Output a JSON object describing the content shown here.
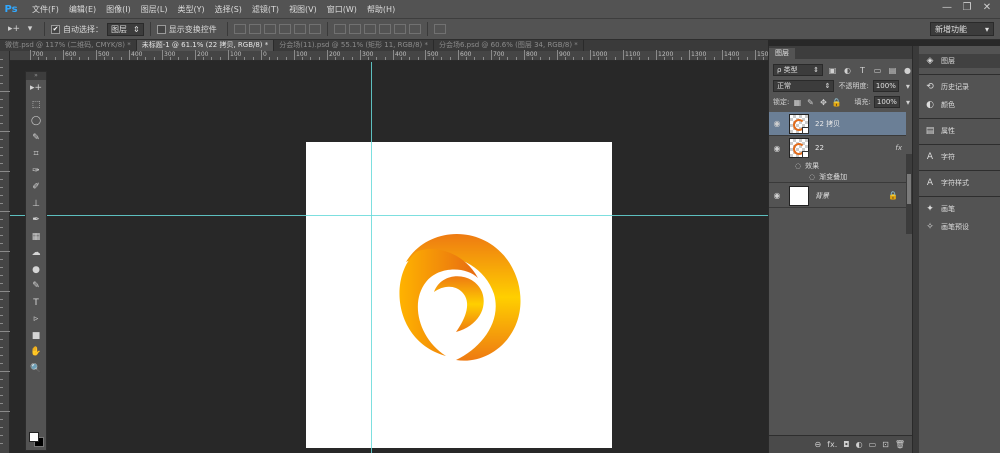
{
  "app": {
    "logo": "Ps"
  },
  "menu": [
    "文件(F)",
    "编辑(E)",
    "图像(I)",
    "图层(L)",
    "类型(Y)",
    "选择(S)",
    "滤镜(T)",
    "视图(V)",
    "窗口(W)",
    "帮助(H)"
  ],
  "window_controls": {
    "minimize": "—",
    "restore": "❐",
    "close": "✕"
  },
  "options": {
    "auto_select_label": "自动选择：",
    "auto_select_checked": "✔",
    "auto_select_value": "图层",
    "show_transform_label": "显示变换控件",
    "workspace": "新增功能"
  },
  "tabs": [
    {
      "label": "微信.psd @ 117% (二维码, CMYK/8) *",
      "active": false
    },
    {
      "label": "未标题-1 @ 61.1% (22 拷贝, RGB/8) *",
      "active": true
    },
    {
      "label": "分会场(11).psd @ 55.1% (矩形 11, RGB/8) *",
      "active": false
    },
    {
      "label": "分会场6.psd @ 60.6% (图层 34, RGB/8) *",
      "active": false
    }
  ],
  "ruler_top_labels": [
    "700",
    "600",
    "500",
    "400",
    "300",
    "200",
    "100",
    "0",
    "100",
    "200",
    "300",
    "400",
    "500",
    "600",
    "700",
    "800",
    "900",
    "1000",
    "1100",
    "1200",
    "1300",
    "1400",
    "1500"
  ],
  "tools": [
    "▸+",
    "⬚",
    "◯",
    "✎",
    "⌗",
    "✑",
    "✐",
    "⊥",
    "✒",
    "▦",
    "☁",
    "●",
    "✎",
    "T",
    "▹",
    "■",
    "✋",
    "🔍"
  ],
  "layers_panel": {
    "tab": "图层",
    "filter_kind": "ρ 类型",
    "blend_mode": "正常",
    "opacity_label": "不透明度:",
    "opacity_value": "100%",
    "lock_label": "锁定:",
    "fill_label": "填充:",
    "fill_value": "100%",
    "layers": [
      {
        "name": "22 拷贝",
        "selected": true
      },
      {
        "name": "22",
        "selected": false,
        "fx": "fx",
        "effects_label": "效果",
        "effect": "渐变叠加"
      },
      {
        "name": "背景",
        "selected": false
      }
    ]
  },
  "dock": [
    {
      "label": "图层",
      "icon": "layers-icon",
      "glyph": "◈",
      "active": true
    },
    {
      "label": "历史记录",
      "icon": "history-icon",
      "glyph": "⟲",
      "active": false
    },
    {
      "label": "颜色",
      "icon": "color-icon",
      "glyph": "◐",
      "active": false
    },
    {
      "label": "属性",
      "icon": "properties-icon",
      "glyph": "▤",
      "active": false
    },
    {
      "label": "字符",
      "icon": "character-icon",
      "glyph": "A",
      "active": false
    },
    {
      "label": "字符样式",
      "icon": "character-style-icon",
      "glyph": "A",
      "active": false
    },
    {
      "label": "画笔",
      "icon": "brush-icon",
      "glyph": "✦",
      "active": false
    },
    {
      "label": "画笔预设",
      "icon": "brush-preset-icon",
      "glyph": "✧",
      "active": false
    }
  ],
  "colors": {
    "accent_layer": "#6b7f96",
    "guide": "#66d9d9",
    "logo_orange": "#e36b1a",
    "logo_yellow": "#ffd500"
  }
}
